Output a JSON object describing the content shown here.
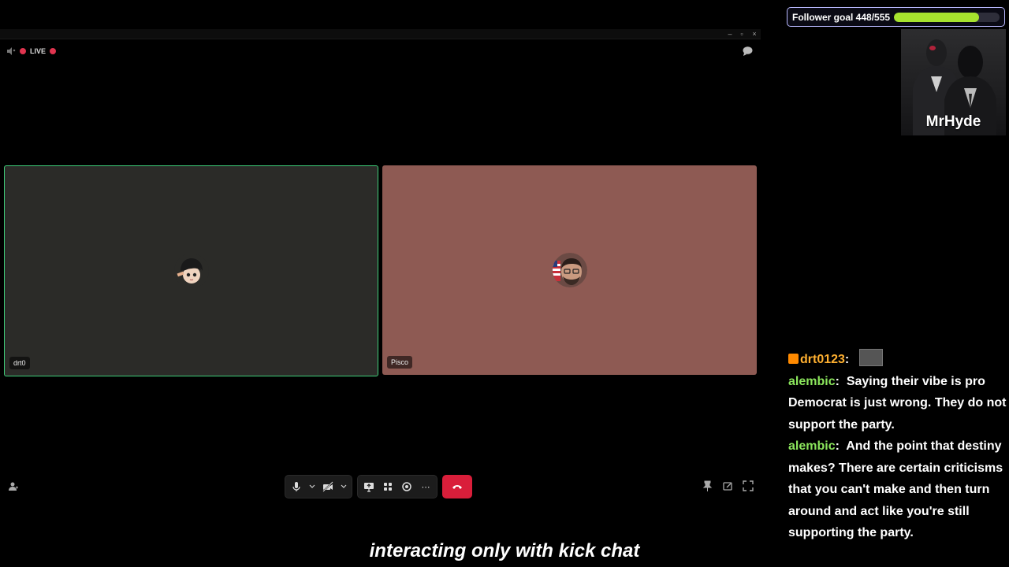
{
  "call": {
    "live_label": "LIVE",
    "participants": [
      {
        "name": "drt0"
      },
      {
        "name": "Pisco"
      }
    ]
  },
  "subtitle": "interacting only with kick chat",
  "follower_goal": {
    "label": "Follower goal 448/555",
    "current": 448,
    "target": 555,
    "bar_color": "#a6e22e"
  },
  "webcam": {
    "name": "MrHyde"
  },
  "chat": {
    "messages": [
      {
        "user": "drt0123",
        "sep": ":",
        "text": "",
        "user_color": "#ffb030"
      },
      {
        "user": "alembic",
        "sep": ":",
        "text": "Saying their vibe is pro Democrat is just wrong. They do not support the party.",
        "user_color": "#8be55c"
      },
      {
        "user": "alembic",
        "sep": ":",
        "text": "And the point that destiny makes? There are certain criticisms that you can't make and then turn around and act like you're still supporting the party.",
        "user_color": "#8be55c"
      }
    ]
  },
  "colors": {
    "end_call": "#d91e3a",
    "speaking_border": "#3fcf7a",
    "tile_2_bg": "#8e5a53"
  }
}
